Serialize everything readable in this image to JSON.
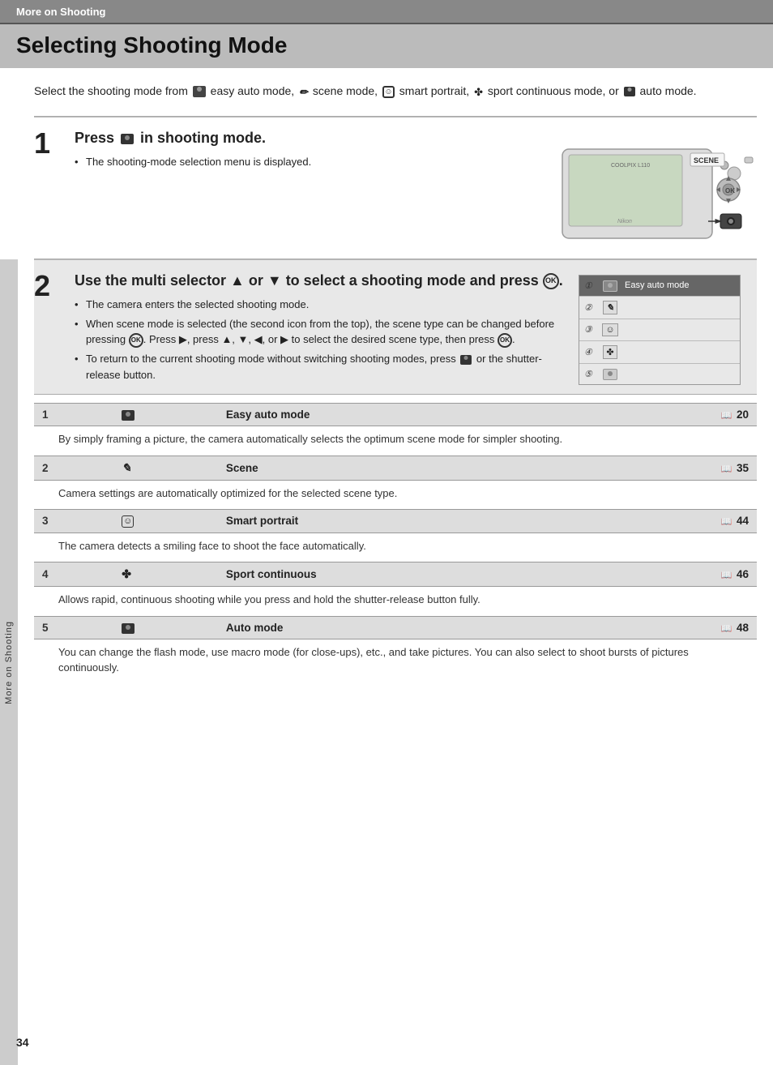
{
  "header": {
    "breadcrumb": "More on Shooting"
  },
  "title": "Selecting Shooting Mode",
  "intro": {
    "text": "Select the shooting mode from",
    "modes": [
      {
        "icon": "easy-auto-icon",
        "label": "easy auto mode,"
      },
      {
        "icon": "scene-icon",
        "label": "scene mode,"
      },
      {
        "icon": "smart-portrait-icon",
        "label": "smart portrait,"
      },
      {
        "icon": "sport-icon",
        "label": "sport continuous mode, or"
      },
      {
        "icon": "auto-icon",
        "label": "auto mode."
      }
    ]
  },
  "steps": [
    {
      "number": "1",
      "heading": "Press in shooting mode.",
      "bullets": [
        "The shooting-mode selection menu is displayed."
      ]
    },
    {
      "number": "2",
      "heading": "Use the multi selector ▲ or ▼ to select a shooting mode and press .",
      "bullets": [
        "The camera enters the selected shooting mode.",
        "When scene mode is selected (the second icon from the top), the scene type can be changed before pressing . Press ▶, press ▲, ▼, ◀, or ▶ to select the desired scene type, then press .",
        "To return to the current shooting mode without switching shooting modes, press  or the shutter-release button."
      ]
    }
  ],
  "modes": [
    {
      "num": "①",
      "icon": "📷",
      "label": "Easy auto mode",
      "active": true
    },
    {
      "num": "②",
      "icon": "✏",
      "label": "",
      "active": false
    },
    {
      "num": "③",
      "icon": "☺",
      "label": "",
      "active": false
    },
    {
      "num": "④",
      "icon": "🏃",
      "label": "",
      "active": false
    },
    {
      "num": "⑤",
      "icon": "📷",
      "label": "",
      "active": false
    }
  ],
  "reference_items": [
    {
      "num": "1",
      "icon_text": "📷",
      "label": "Easy auto mode",
      "page": "20",
      "description": "By simply framing a picture, the camera automatically selects the optimum scene mode for simpler shooting."
    },
    {
      "num": "2",
      "icon_text": "✏",
      "label": "Scene",
      "page": "35",
      "description": "Camera settings are automatically optimized for the selected scene type."
    },
    {
      "num": "3",
      "icon_text": "☺",
      "label": "Smart portrait",
      "page": "44",
      "description": "The camera detects a smiling face to shoot the face automatically."
    },
    {
      "num": "4",
      "icon_text": "🏃",
      "label": "Sport continuous",
      "page": "46",
      "description": "Allows rapid, continuous shooting while you press and hold the shutter-release button fully."
    },
    {
      "num": "5",
      "icon_text": "📷",
      "label": "Auto mode",
      "page": "48",
      "description": "You can change the flash mode, use macro mode (for close-ups), etc., and take pictures. You can also select to shoot bursts of pictures continuously."
    }
  ],
  "sidebar_label": "More on Shooting",
  "page_number": "34",
  "labels": {
    "scene_button": "SCENE",
    "easy_auto_mode": "Easy auto mode"
  }
}
